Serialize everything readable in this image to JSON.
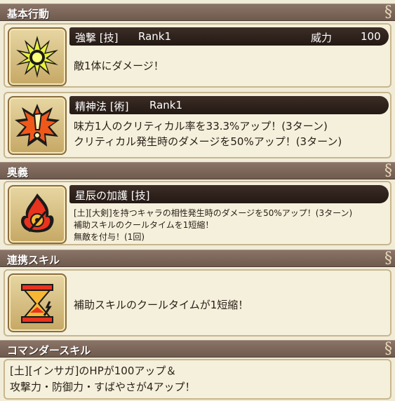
{
  "sections": {
    "basic": "基本行動",
    "ougi": "奥義",
    "renkei": "連携スキル",
    "commander": "コマンダースキル"
  },
  "skill1": {
    "name": "強撃 [技]",
    "rank": "Rank1",
    "power_label": "威力",
    "power_value": "100",
    "desc1": "敵1体にダメージ！",
    "icon": "burst-star-icon"
  },
  "skill2": {
    "name": "精神法 [術]",
    "rank": "Rank1",
    "desc1": "味方1人のクリティカル率を33.3%アップ！(3ターン)",
    "desc2": "クリティカル発生時のダメージを50%アップ！(3ターン)",
    "icon": "exclamation-burst-icon"
  },
  "ougi": {
    "name": "星辰の加護 [技]",
    "desc1": "[土][大剣]を持つキャラの相性発生時のダメージを50%アップ！(3ターン)",
    "desc2": "補助スキルのクールタイムを1短縮！",
    "desc3": "無敵を付与！(1回)",
    "icon": "flame-emblem-icon"
  },
  "renkei": {
    "desc1": "補助スキルのクールタイムが1短縮！",
    "icon": "hourglass-icon"
  },
  "commander": {
    "line1": "[土][インサガ]のHPが100アップ＆",
    "line2": "攻撃力・防御力・すばやさが4アップ！"
  },
  "colors": {
    "header": "#7d685b",
    "card_bg": "#f5f0dc",
    "name_bar": "#2e211b"
  }
}
